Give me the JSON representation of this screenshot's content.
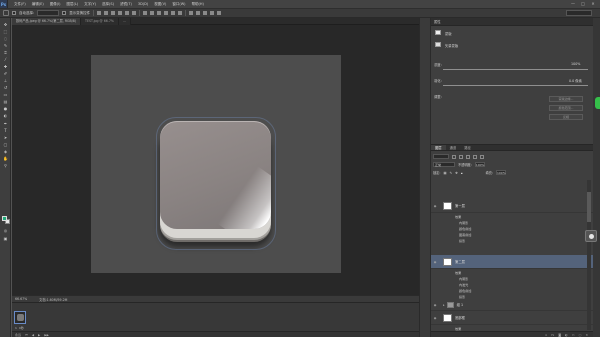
{
  "app": {
    "logo": "Ps",
    "menus": [
      "文件(F)",
      "编辑(E)",
      "图像(I)",
      "图层(L)",
      "文字(Y)",
      "选择(S)",
      "滤镜(T)",
      "3D(D)",
      "视图(V)",
      "窗口(W)",
      "帮助(H)"
    ],
    "window_controls": [
      "—",
      "□",
      "✕"
    ]
  },
  "options_bar": {
    "auto_select_label": "自动选择:",
    "show_transform_label": "显示变换控件"
  },
  "document": {
    "tabs": [
      {
        "title": "数码产品.jpeg @ 66.7%(第二层, RGB/8)",
        "active": true
      },
      {
        "title": "TEST.jpg @ 66.7%",
        "active": false
      },
      {
        "title": "...",
        "active": false
      }
    ],
    "zoom": "66.67%",
    "doc_info": "文档:1.60M/59.2M"
  },
  "timeline": {
    "frame_label": "1",
    "frame_time": "0秒",
    "loop": "永远"
  },
  "properties": {
    "title": "属性",
    "section": "蒙版",
    "mask_kind": "矢量蒙版",
    "density_label": "浓度:",
    "density_value": "100%",
    "feather_label": "羽化:",
    "feather_value": "0.0 像素",
    "refine_label": "调整:",
    "buttons": [
      "蒙版边缘...",
      "颜色范围...",
      "反相"
    ]
  },
  "layers": {
    "tabs": [
      "图层",
      "通道",
      "路径"
    ],
    "blend_mode": "正常",
    "opacity_label": "不透明度:",
    "opacity_value": "100%",
    "lock_label": "锁定:",
    "fill_label": "填充:",
    "fill_value": "100%",
    "rows": [
      {
        "name": "第一层",
        "selected": false,
        "fx": true,
        "effects_label": "效果",
        "effects": [
          "内阴影",
          "颜色叠加",
          "图案叠加",
          "投影"
        ]
      },
      {
        "name": "第二层",
        "selected": true,
        "fx": true,
        "effects_label": "效果",
        "effects": [
          "内阴影",
          "内发光",
          "颜色叠加",
          "投影"
        ]
      },
      {
        "name": "组 1",
        "selected": false,
        "fx": false,
        "effects_label": "",
        "effects": []
      },
      {
        "name": "底部框",
        "selected": false,
        "fx": true,
        "effects_label": "效果",
        "effects": [
          "内发光",
          "渐变叠加",
          "投影"
        ]
      }
    ],
    "footer_icons": [
      "链接",
      "fx",
      "蒙版",
      "调整",
      "组",
      "新建",
      "删除"
    ]
  },
  "colors": {
    "foreground": "#22aa7a",
    "background": "#e8e8e8",
    "selection": "#54637b",
    "accent_green": "#35c04a"
  }
}
